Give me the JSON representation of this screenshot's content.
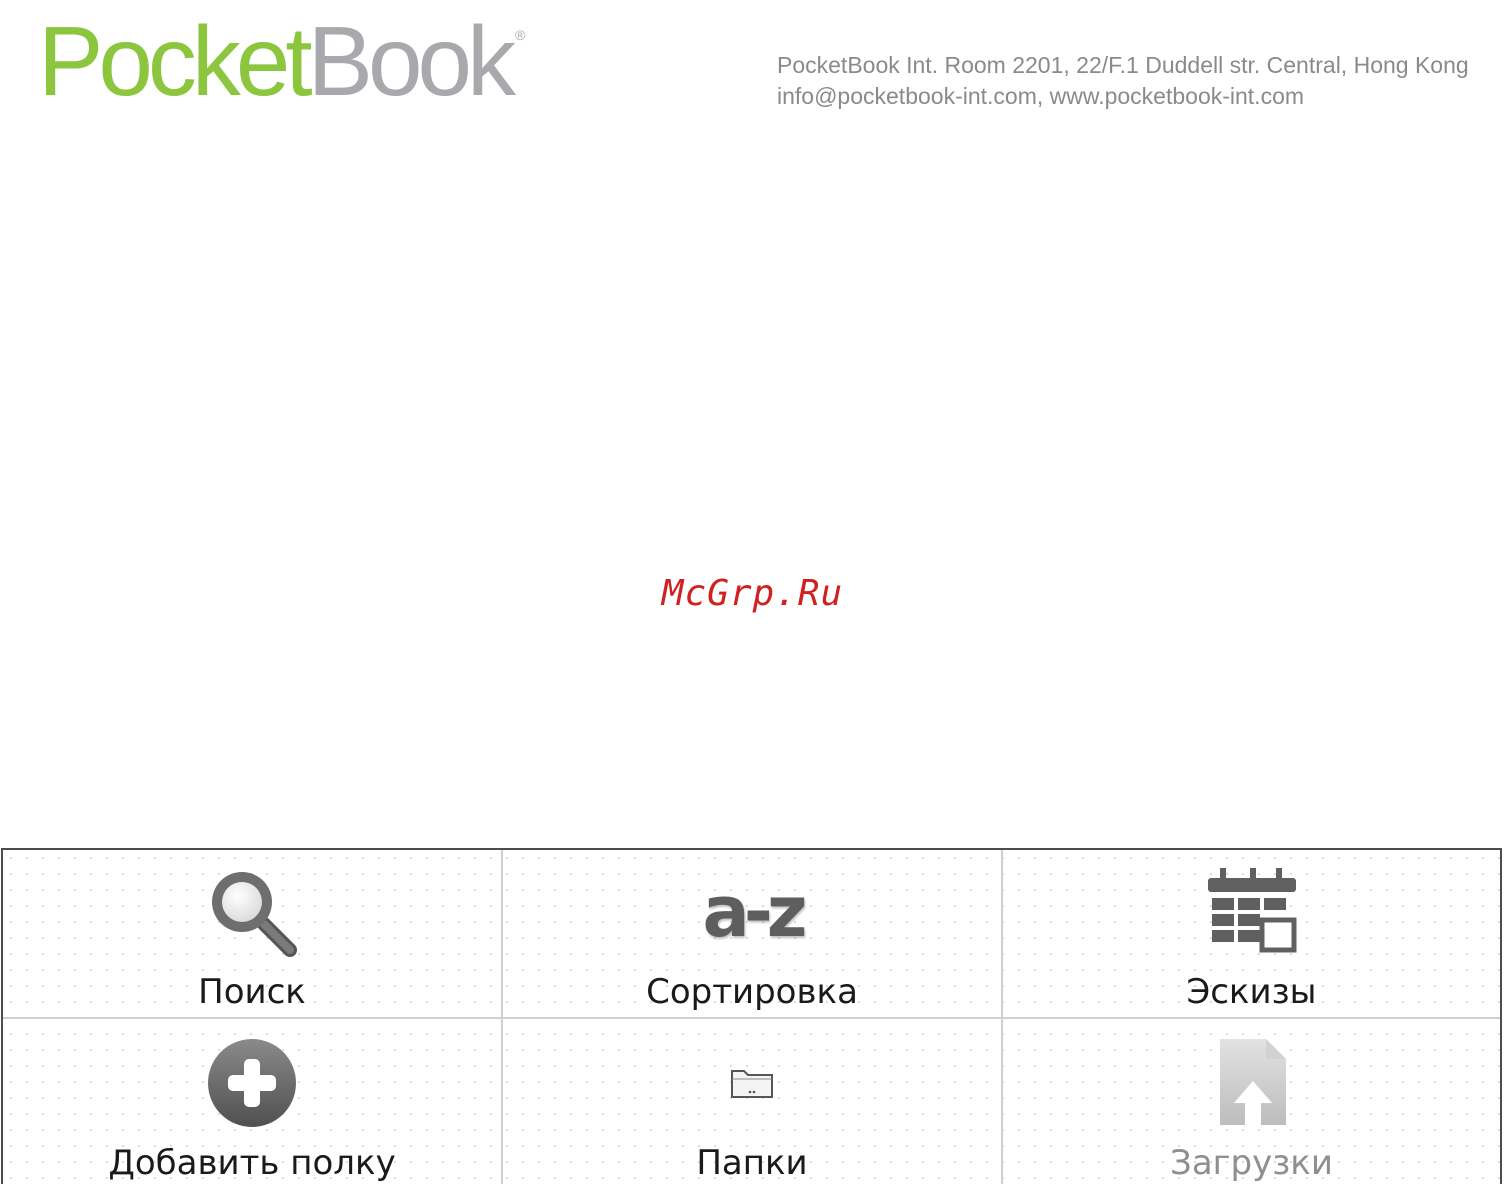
{
  "header": {
    "logo_part1": "Pocket",
    "logo_part2": "Book",
    "logo_mark": "®",
    "address_line1": "PocketBook Int. Room 2201, 22/F.1 Duddell str. Central, Hong Kong",
    "address_line2": "info@pocketbook-int.com, www.pocketbook-int.com"
  },
  "watermark": "McGrp.Ru",
  "menu": {
    "items": [
      {
        "label": "Поиск",
        "icon": "search-icon"
      },
      {
        "label": "Сортировка",
        "icon": "sort-az-icon",
        "icon_text": "a-z"
      },
      {
        "label": "Эскизы",
        "icon": "thumbnails-icon"
      },
      {
        "label": "Добавить полку",
        "icon": "add-shelf-icon"
      },
      {
        "label": "Папки",
        "icon": "folder-icon"
      },
      {
        "label": "Загрузки",
        "icon": "downloads-icon"
      }
    ]
  },
  "colors": {
    "logo_green": "#8cc63f",
    "logo_gray": "#a7a9ac",
    "watermark_red": "#d12020",
    "panel_border": "#4d4d4d",
    "disabled_text": "#8f8f8f"
  }
}
